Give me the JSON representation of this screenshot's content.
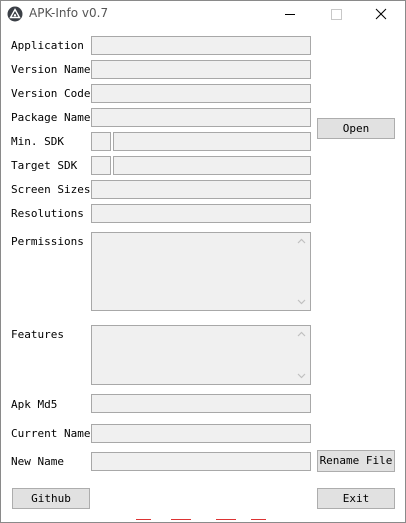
{
  "window": {
    "title": "APK-Info v0.7",
    "controls": {
      "minimize": "minimize-icon",
      "maximize": "maximize-icon",
      "close": "close-icon"
    }
  },
  "fields": {
    "application": {
      "label": "Application",
      "value": ""
    },
    "version_name": {
      "label": "Version Name",
      "value": ""
    },
    "version_code": {
      "label": "Version Code",
      "value": ""
    },
    "package_name": {
      "label": "Package Name",
      "value": ""
    },
    "min_sdk": {
      "label": "Min. SDK",
      "value": "",
      "detail": ""
    },
    "target_sdk": {
      "label": "Target SDK",
      "value": "",
      "detail": ""
    },
    "screen_sizes": {
      "label": "Screen Sizes",
      "value": ""
    },
    "resolutions": {
      "label": "Resolutions",
      "value": ""
    },
    "permissions": {
      "label": "Permissions",
      "value": ""
    },
    "features": {
      "label": "Features",
      "value": ""
    },
    "apk_md5": {
      "label": "Apk Md5",
      "value": ""
    },
    "current_name": {
      "label": "Current Name",
      "value": ""
    },
    "new_name": {
      "label": "New Name",
      "value": ""
    }
  },
  "buttons": {
    "open": "Open",
    "rename_file": "Rename File",
    "github": "Github",
    "exit": "Exit"
  },
  "colors": {
    "field_bg": "#f0f0f0",
    "button_bg": "#e1e1e1",
    "border": "#a8a8a8"
  }
}
